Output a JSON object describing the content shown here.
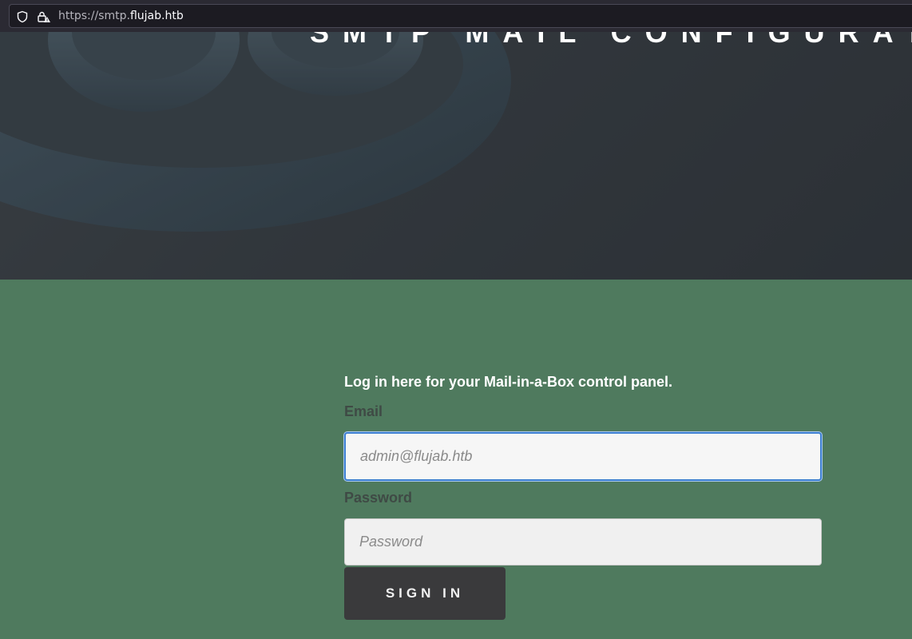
{
  "browser": {
    "url_prefix": "https://smtp.",
    "url_domain": "flujab.htb",
    "icons": [
      "shield-icon",
      "lock-warning-icon"
    ]
  },
  "hero": {
    "title": "SMTP MAIL CONFIGURATION"
  },
  "login": {
    "intro": "Log in here for your Mail-in-a-Box control panel.",
    "email_label": "Email",
    "email_placeholder": "admin@flujab.htb",
    "password_label": "Password",
    "password_placeholder": "Password",
    "signin_label": "SIGN IN"
  },
  "colors": {
    "section_bg": "#4f7a5e",
    "button_bg": "#3a3a3c",
    "focus_border": "#3d7fd1"
  }
}
